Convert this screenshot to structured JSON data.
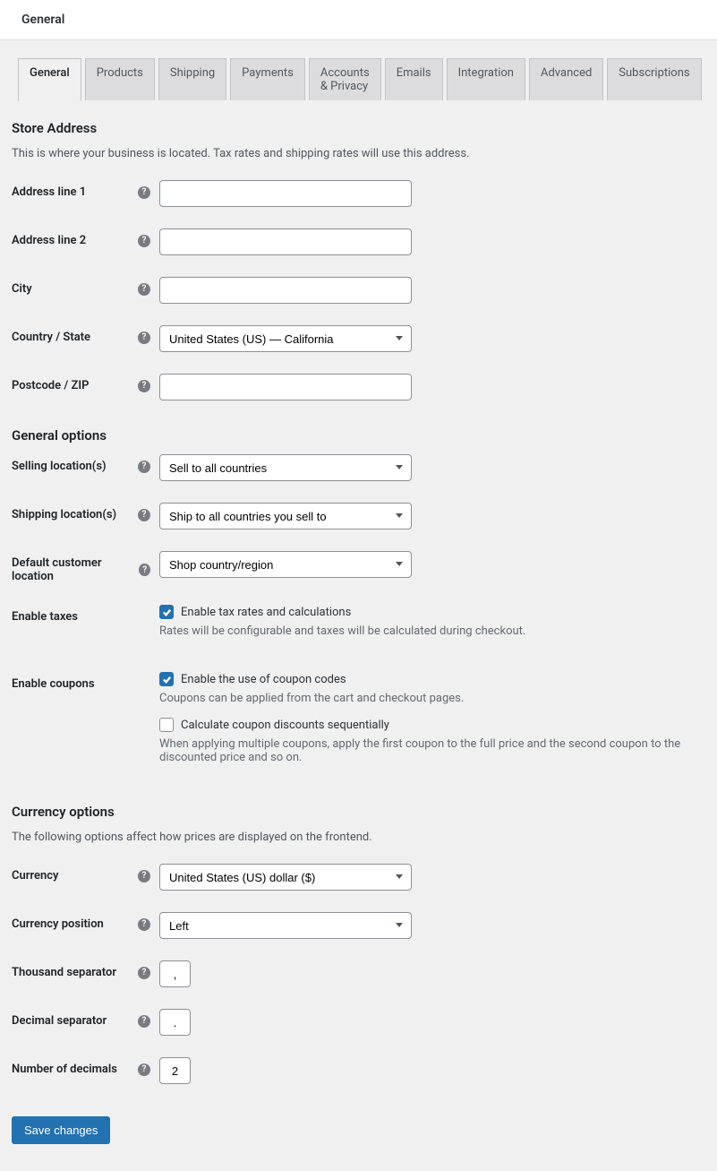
{
  "header_title": "General",
  "tabs": [
    "General",
    "Products",
    "Shipping",
    "Payments",
    "Accounts & Privacy",
    "Emails",
    "Integration",
    "Advanced",
    "Subscriptions"
  ],
  "sections": {
    "store_address": {
      "title": "Store Address",
      "desc": "This is where your business is located. Tax rates and shipping rates will use this address.",
      "fields": {
        "address1": {
          "label": "Address line 1",
          "value": ""
        },
        "address2": {
          "label": "Address line 2",
          "value": ""
        },
        "city": {
          "label": "City",
          "value": ""
        },
        "country": {
          "label": "Country / State",
          "value": "United States (US) — California"
        },
        "postcode": {
          "label": "Postcode / ZIP",
          "value": ""
        }
      }
    },
    "general_options": {
      "title": "General options",
      "fields": {
        "selling": {
          "label": "Selling location(s)",
          "value": "Sell to all countries"
        },
        "shipping": {
          "label": "Shipping location(s)",
          "value": "Ship to all countries you sell to"
        },
        "default_loc": {
          "label": "Default customer location",
          "value": "Shop country/region"
        },
        "taxes": {
          "label": "Enable taxes",
          "checkbox_label": "Enable tax rates and calculations",
          "checked": true,
          "desc": "Rates will be configurable and taxes will be calculated during checkout."
        },
        "coupons": {
          "label": "Enable coupons",
          "cb1_label": "Enable the use of coupon codes",
          "cb1_checked": true,
          "cb1_desc": "Coupons can be applied from the cart and checkout pages.",
          "cb2_label": "Calculate coupon discounts sequentially",
          "cb2_checked": false,
          "cb2_desc": "When applying multiple coupons, apply the first coupon to the full price and the second coupon to the discounted price and so on."
        }
      }
    },
    "currency_options": {
      "title": "Currency options",
      "desc": "The following options affect how prices are displayed on the frontend.",
      "fields": {
        "currency": {
          "label": "Currency",
          "value": "United States (US) dollar ($)"
        },
        "position": {
          "label": "Currency position",
          "value": "Left"
        },
        "thousand": {
          "label": "Thousand separator",
          "value": ","
        },
        "decimal": {
          "label": "Decimal separator",
          "value": "."
        },
        "num_decimals": {
          "label": "Number of decimals",
          "value": "2"
        }
      }
    }
  },
  "save_button": "Save changes",
  "help_glyph": "?"
}
